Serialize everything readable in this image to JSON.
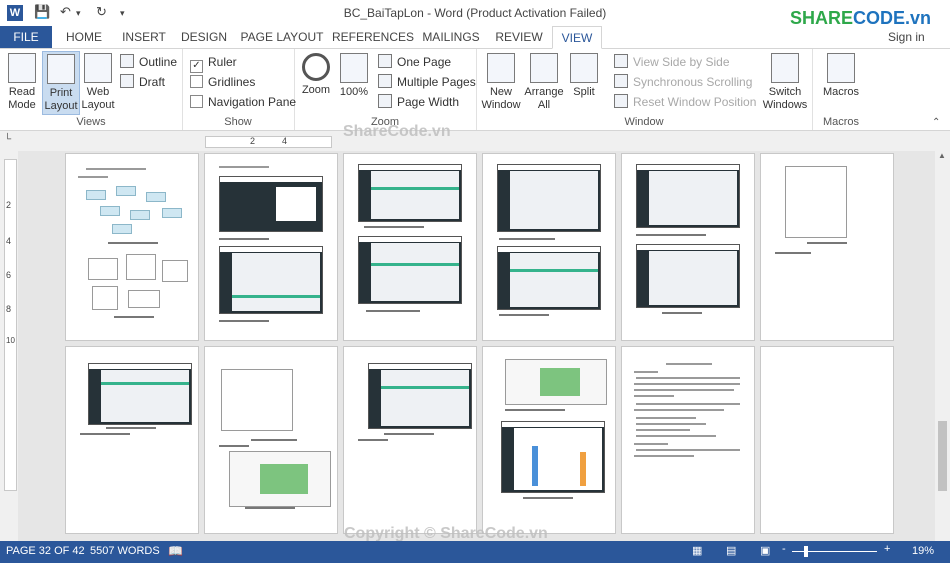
{
  "window": {
    "title": "BC_BaiTapLon - Word (Product Activation Failed)",
    "sign_in": "Sign in"
  },
  "brand": {
    "part1": "SHARE",
    "part2": "CODE.vn"
  },
  "tabs": [
    {
      "id": "file",
      "label": "FILE"
    },
    {
      "id": "home",
      "label": "HOME"
    },
    {
      "id": "insert",
      "label": "INSERT"
    },
    {
      "id": "design",
      "label": "DESIGN"
    },
    {
      "id": "page_layout",
      "label": "PAGE LAYOUT"
    },
    {
      "id": "references",
      "label": "REFERENCES"
    },
    {
      "id": "mailings",
      "label": "MAILINGS"
    },
    {
      "id": "review",
      "label": "REVIEW"
    },
    {
      "id": "view",
      "label": "VIEW"
    }
  ],
  "ribbon": {
    "views": {
      "label": "Views",
      "read_mode": "Read Mode",
      "print_layout": "Print Layout",
      "web_layout": "Web Layout",
      "outline": "Outline",
      "draft": "Draft"
    },
    "show": {
      "label": "Show",
      "ruler": "Ruler",
      "gridlines": "Gridlines",
      "navigation_pane": "Navigation Pane",
      "ruler_checked": true
    },
    "zoom": {
      "label": "Zoom",
      "zoom": "Zoom",
      "hundred": "100%",
      "one_page": "One Page",
      "multiple_pages": "Multiple Pages",
      "page_width": "Page Width"
    },
    "window_grp": {
      "label": "Window",
      "new_window": "New Window",
      "arrange_all": "Arrange All",
      "split": "Split",
      "view_side_by_side": "View Side by Side",
      "synchronous_scrolling": "Synchronous Scrolling",
      "reset_window_position": "Reset Window Position",
      "switch_windows": "Switch Windows"
    },
    "macros": {
      "label": "Macros",
      "macros": "Macros"
    }
  },
  "ruler": {
    "marks": [
      "2",
      "4"
    ],
    "vmarks": [
      "2",
      "4",
      "6",
      "8",
      "10"
    ]
  },
  "watermarks": {
    "top": "ShareCode.vn",
    "bottom": "Copyright © ShareCode.vn"
  },
  "status": {
    "page": "PAGE 32 OF 42",
    "words": "5507 WORDS",
    "zoom": "19%",
    "zoom_minus": "-",
    "zoom_plus": "+"
  },
  "colors": {
    "accent": "#2b579a",
    "teal": "#35b38c",
    "dark": "#263238"
  }
}
